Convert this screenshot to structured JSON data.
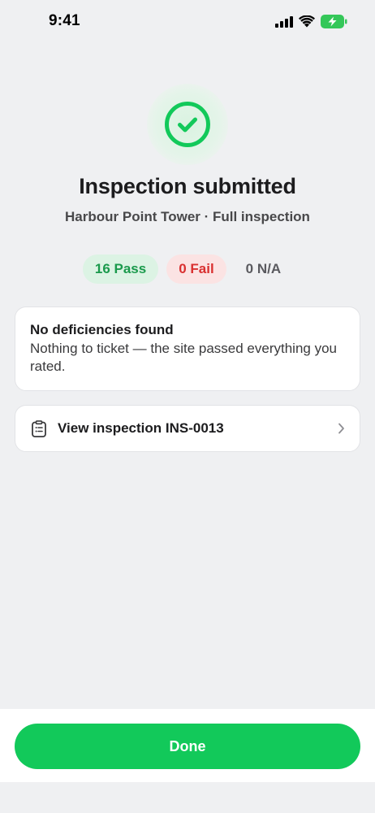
{
  "status_bar": {
    "time": "9:41",
    "icons": [
      "signal-icon",
      "wifi-icon",
      "battery-charging-icon"
    ],
    "battery_color": "#34c759"
  },
  "hero": {
    "icon": "check-circle-icon",
    "accent": "#12c95a",
    "title": "Inspection submitted",
    "subtitle": "Harbour Point Tower · Full inspection"
  },
  "results": {
    "pass": "16 Pass",
    "fail": "0 Fail",
    "na": "0 N/A",
    "pass_color": "#1a9a4c",
    "fail_color": "#d93030"
  },
  "notice": {
    "title": "No deficiencies found",
    "body": "Nothing to ticket — the site passed everything you rated."
  },
  "inspection_link": {
    "icon": "clipboard-icon",
    "label": "View inspection INS-0013",
    "chevron": "chevron-right-icon"
  },
  "footer": {
    "done_label": "Done"
  }
}
